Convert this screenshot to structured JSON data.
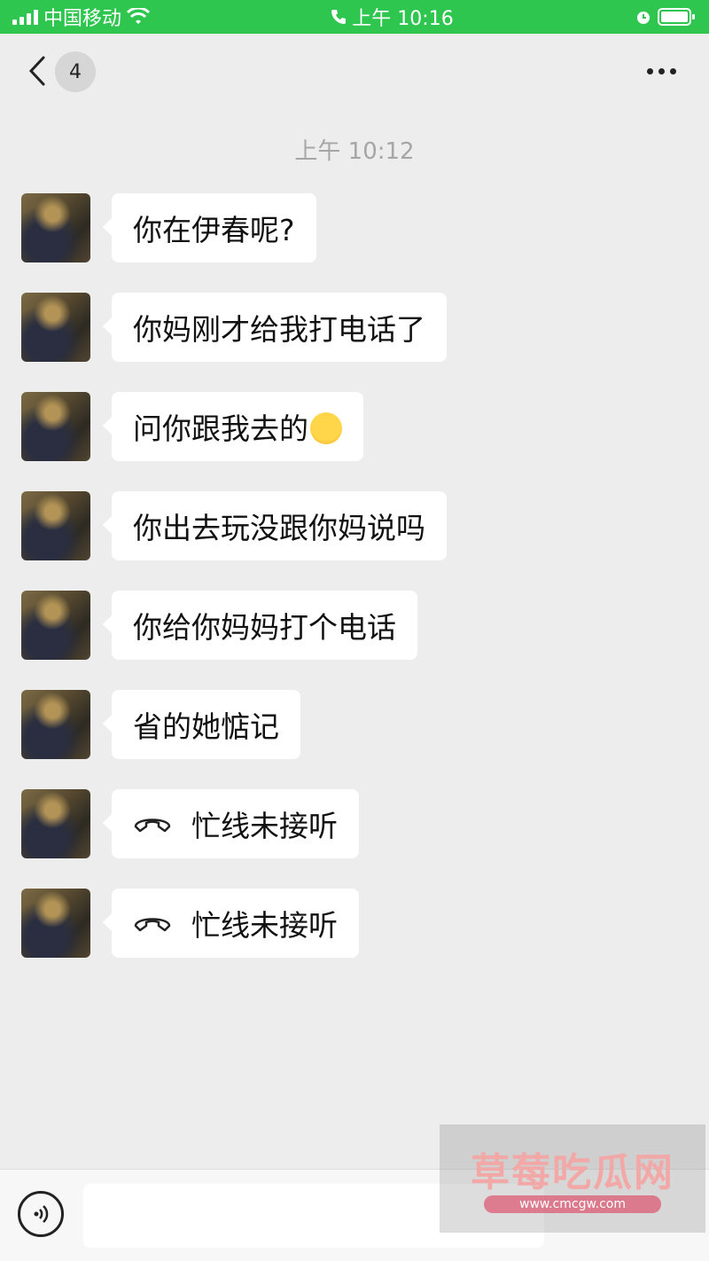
{
  "status_bar": {
    "carrier": "中国移动",
    "time": "上午 10:16"
  },
  "nav": {
    "unread_count": "4"
  },
  "chat": {
    "timestamp": "上午 10:12",
    "messages": [
      {
        "type": "text",
        "text": "你在伊春呢?"
      },
      {
        "type": "text",
        "text": "你妈刚才给我打电话了"
      },
      {
        "type": "text",
        "text": "问你跟我去的",
        "emoji": "laughing-crying-emoji"
      },
      {
        "type": "text",
        "text": "你出去玩没跟你妈说吗"
      },
      {
        "type": "text",
        "text": "你给你妈妈打个电话"
      },
      {
        "type": "text",
        "text": "省的她惦记"
      },
      {
        "type": "call",
        "text": "忙线未接听",
        "icon": "phone-hangup-icon"
      },
      {
        "type": "call",
        "text": "忙线未接听",
        "icon": "phone-hangup-icon"
      }
    ]
  },
  "input": {
    "value": ""
  },
  "watermark": {
    "title": "草莓吃瓜网",
    "url": "www.cmcgw.com"
  },
  "colors": {
    "status_bar_bg": "#2fc64f",
    "chat_bg": "#ededed",
    "bubble_bg": "#ffffff",
    "timestamp": "#a6a6a6"
  }
}
